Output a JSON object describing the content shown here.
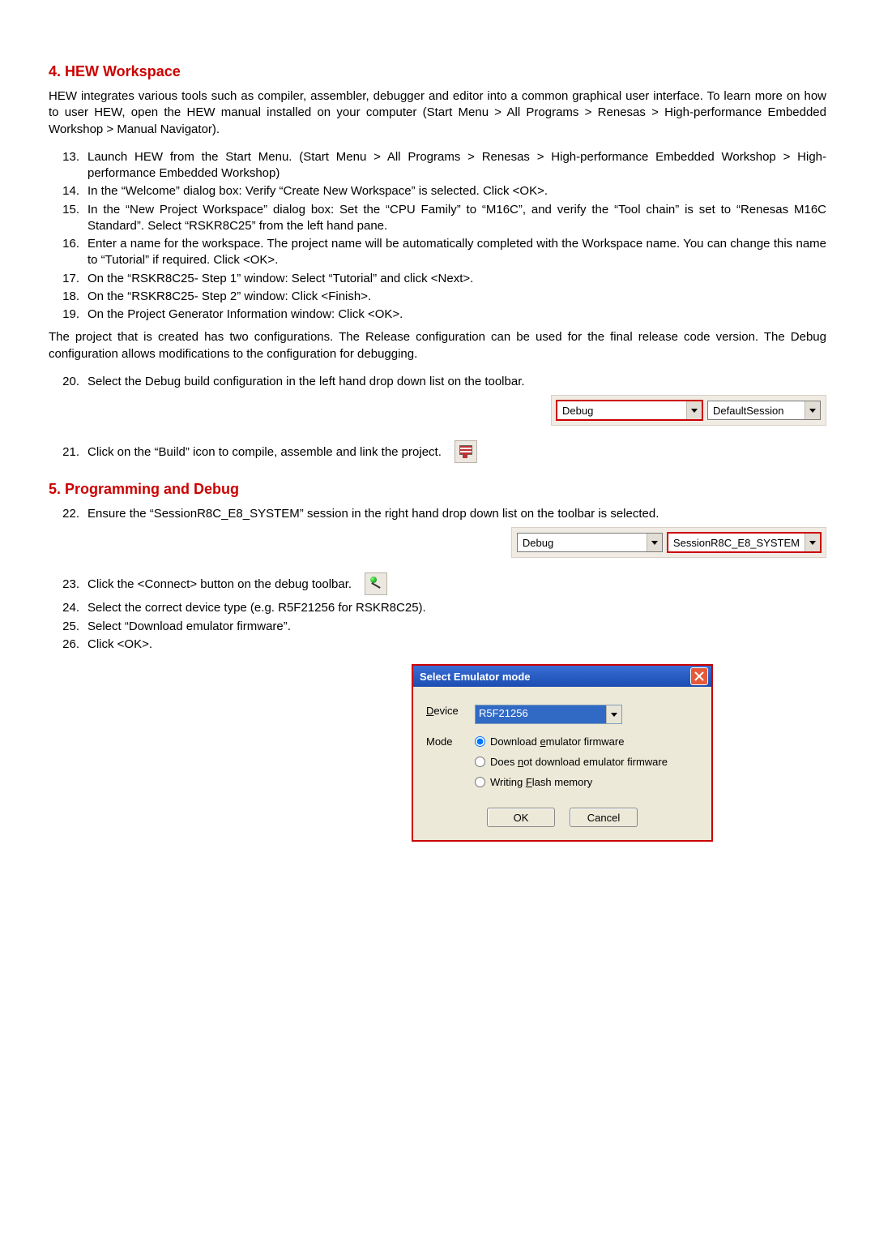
{
  "section4": {
    "heading": "4. HEW Workspace",
    "intro": "HEW integrates various tools such as compiler, assembler, debugger and editor into a common graphical user interface. To learn more on how to user HEW, open the HEW manual installed on your computer (Start Menu > All Programs > Renesas > High-performance Embedded Workshop > Manual Navigator).",
    "steps_a": [
      {
        "n": "13.",
        "t": "Launch HEW from the Start Menu. (Start Menu > All Programs > Renesas > High-performance Embedded Workshop > High-performance Embedded Workshop)"
      },
      {
        "n": "14.",
        "t": "In the “Welcome” dialog box: Verify “Create New Workspace” is selected. Click <OK>."
      },
      {
        "n": "15.",
        "t": "In the “New Project Workspace” dialog box: Set the “CPU Family” to “M16C”, and verify the “Tool chain” is set to “Renesas M16C Standard”. Select “RSKR8C25” from the left hand pane."
      },
      {
        "n": "16.",
        "t": "Enter a name for the workspace. The project name will be automatically completed with the Workspace name. You can change this name to “Tutorial” if required. Click <OK>."
      },
      {
        "n": "17.",
        "t": "On the “RSKR8C25- Step 1” window: Select “Tutorial” and click <Next>."
      },
      {
        "n": "18.",
        "t": "On the “RSKR8C25- Step 2” window: Click <Finish>."
      },
      {
        "n": "19.",
        "t": "On the Project Generator Information window: Click <OK>."
      }
    ],
    "mid": "The project that is created has two configurations. The Release configuration can be used for the final release code version. The Debug configuration allows modifications to the configuration for debugging.",
    "step20": {
      "n": "20.",
      "t": "Select the Debug build configuration in the left hand drop down list on the toolbar."
    },
    "toolbar1": {
      "left": "Debug",
      "right": "DefaultSession"
    },
    "step21": {
      "n": "21.",
      "t": "Click on the “Build” icon to compile, assemble and link the project."
    }
  },
  "section5": {
    "heading": "5. Programming and Debug",
    "step22": {
      "n": "22.",
      "t": "Ensure the “SessionR8C_E8_SYSTEM” session in the right hand drop down list on the toolbar is selected."
    },
    "toolbar2": {
      "left": "Debug",
      "right": "SessionR8C_E8_SYSTEM"
    },
    "step23": {
      "n": "23.",
      "t": "Click the <Connect> button on the debug toolbar."
    },
    "steps_b": [
      {
        "n": "24.",
        "t": "Select the correct device type (e.g. R5F21256 for RSKR8C25)."
      },
      {
        "n": "25.",
        "t": "Select “Download emulator firmware”."
      },
      {
        "n": "26.",
        "t": "Click <OK>."
      }
    ]
  },
  "dialog": {
    "title": "Select Emulator mode",
    "device_label": "Device",
    "device_value": "R5F21256",
    "mode_label": "Mode",
    "opt1_pre": "Download ",
    "opt1_ul": "e",
    "opt1_post": "mulator firmware",
    "opt2_pre": "Does ",
    "opt2_ul": "n",
    "opt2_post": "ot download emulator firmware",
    "opt3_pre": "Writing ",
    "opt3_ul": "F",
    "opt3_post": "lash memory",
    "ok": "OK",
    "cancel": "Cancel"
  }
}
